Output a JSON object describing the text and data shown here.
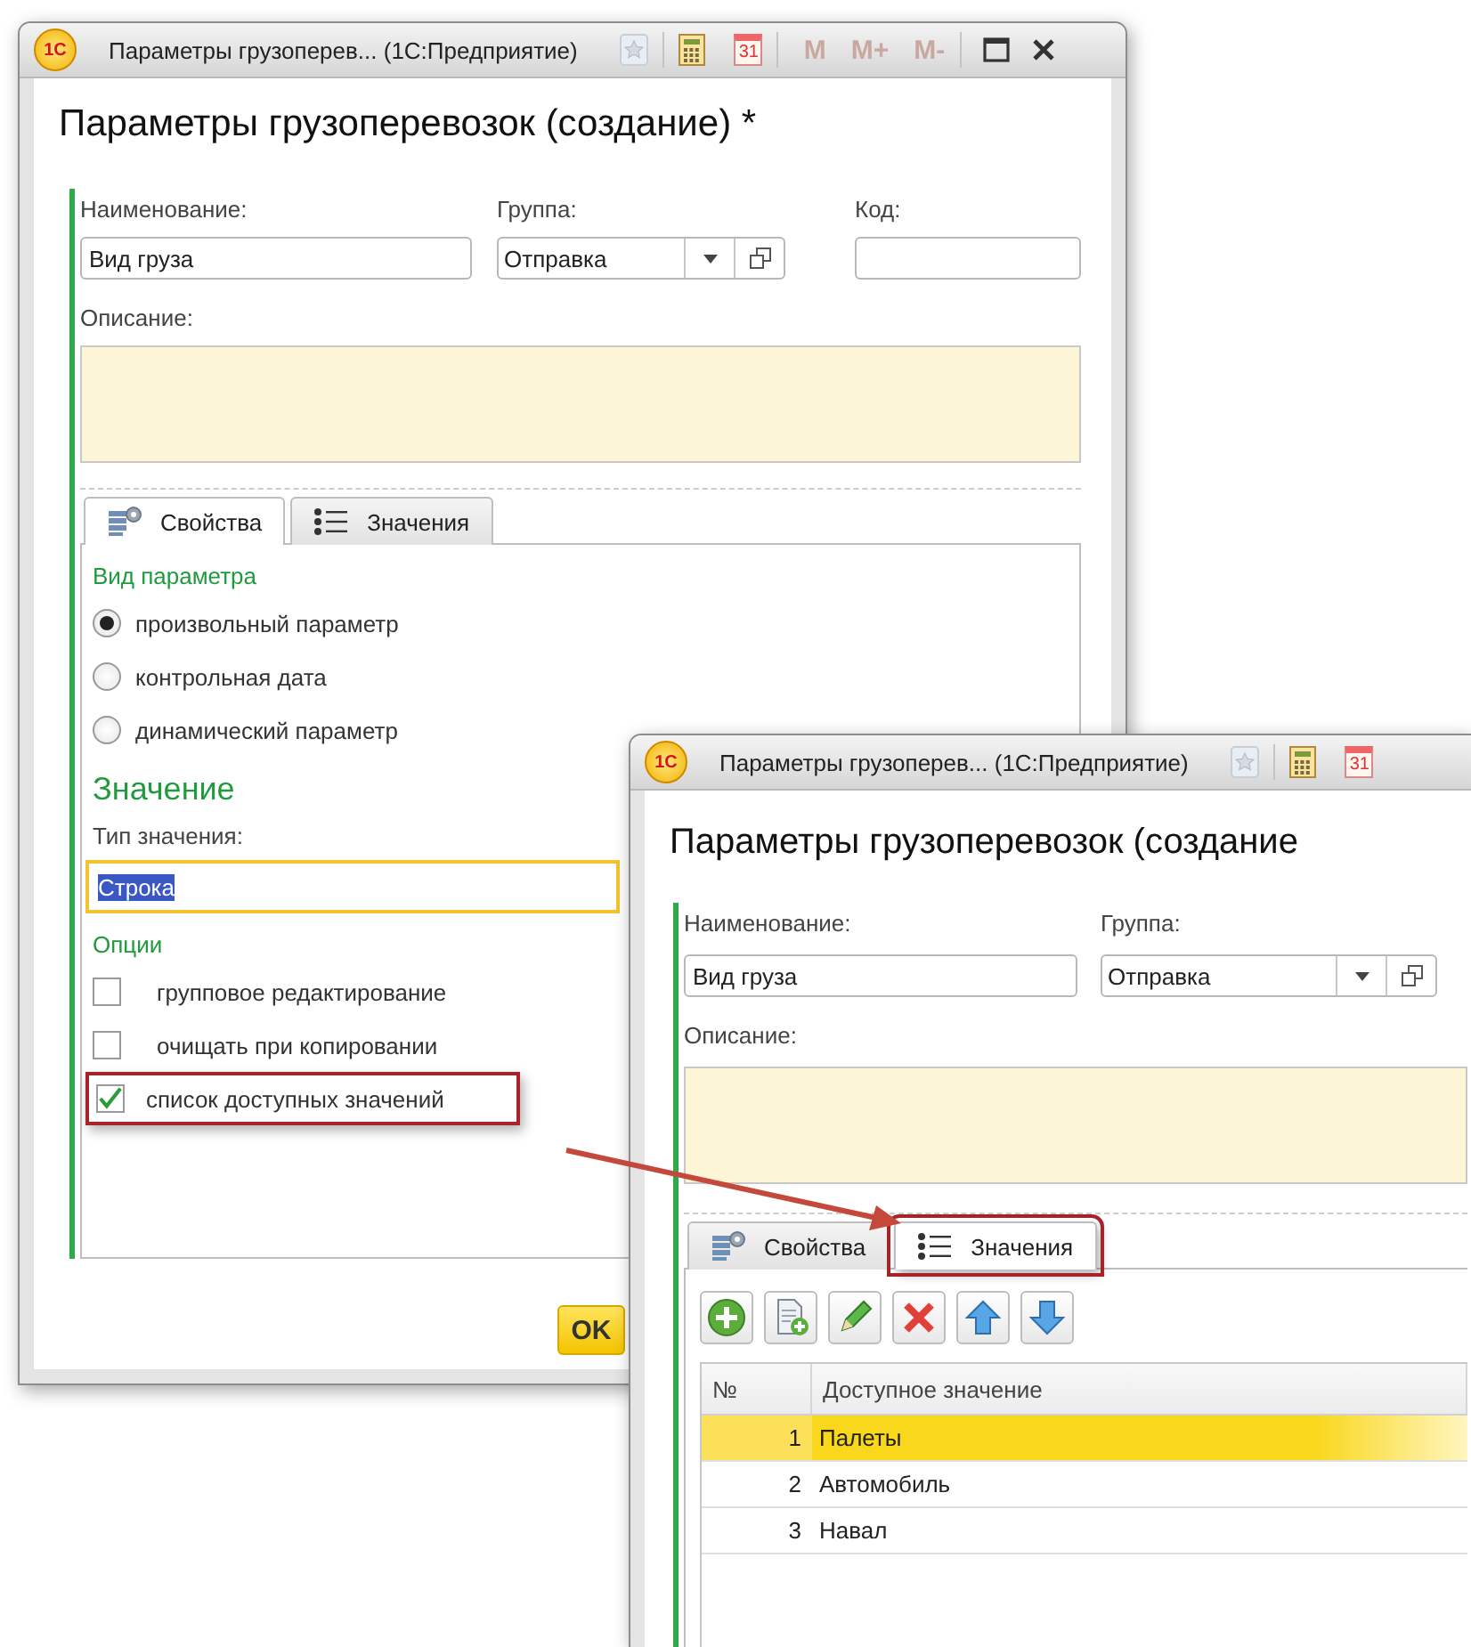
{
  "windows": [
    {
      "kind": "form",
      "title": "Параметры грузоперев... (1С:Предприятие)",
      "logo": "1С",
      "calendar_day": "31",
      "memory_buttons": [
        "M",
        "M+",
        "M-"
      ],
      "heading": "Параметры грузоперевозок (создание) *",
      "name_field": {
        "label": "Наименование:",
        "value": "Вид груза"
      },
      "group_field": {
        "label": "Группа:",
        "value": "Отправка"
      },
      "code_field": {
        "label": "Код:"
      },
      "description_field": {
        "label": "Описание:"
      },
      "tabs": [
        {
          "label": "Свойства",
          "selected": true,
          "highlighted": false
        },
        {
          "label": "Значения",
          "selected": false,
          "highlighted": false
        }
      ],
      "param_kind": {
        "title": "Вид параметра",
        "options": [
          {
            "label": "произвольный параметр",
            "selected": true
          },
          {
            "label": "контрольная дата",
            "selected": false
          },
          {
            "label": "динамический параметр",
            "selected": false
          }
        ]
      },
      "value_section": {
        "title": "Значение",
        "type_label": "Тип значения:",
        "type_value": "Строка"
      },
      "options": {
        "title": "Опции",
        "items": [
          {
            "label": "групповое редактирование",
            "checked": false,
            "highlighted": false
          },
          {
            "label": "очищать при копировании",
            "checked": false,
            "highlighted": false
          },
          {
            "label": "список доступных значений",
            "checked": true,
            "highlighted": true
          }
        ]
      },
      "ok_button": "OK"
    },
    {
      "kind": "values",
      "title": "Параметры грузоперев... (1С:Предприятие)",
      "logo": "1С",
      "calendar_day": "31",
      "heading": "Параметры грузоперевозок (создание",
      "name_field": {
        "label": "Наименование:",
        "value": "Вид груза"
      },
      "group_field": {
        "label": "Группа:",
        "value": "Отправка"
      },
      "description_field": {
        "label": "Описание:"
      },
      "tabs": [
        {
          "label": "Свойства",
          "selected": false,
          "highlighted": false
        },
        {
          "label": "Значения",
          "selected": true,
          "highlighted": true
        }
      ],
      "table": {
        "columns": [
          "№",
          "Доступное значение"
        ],
        "rows": [
          {
            "number": "1",
            "value": "Палеты",
            "selected": true
          },
          {
            "number": "2",
            "value": "Автомобиль",
            "selected": false
          },
          {
            "number": "3",
            "value": "Навал",
            "selected": false
          }
        ]
      }
    }
  ]
}
